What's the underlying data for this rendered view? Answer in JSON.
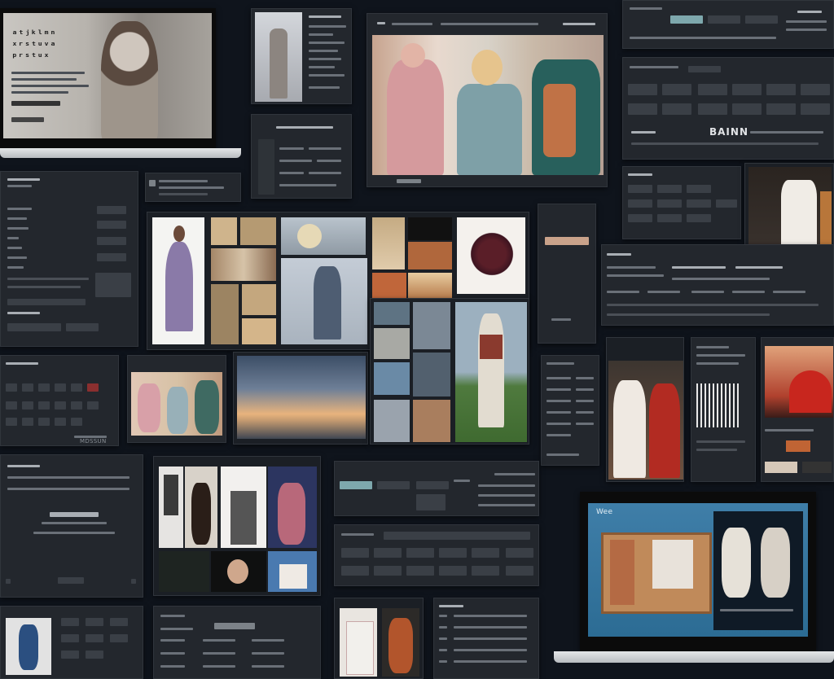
{
  "texts": {
    "laptop_right_label": "Wee",
    "center_bottom_caption": "MDSSUN",
    "right_banner": "BAINN"
  },
  "colors": {
    "background": "#0f141c",
    "panel": "#23272d",
    "accent": "#7ea8ad"
  }
}
